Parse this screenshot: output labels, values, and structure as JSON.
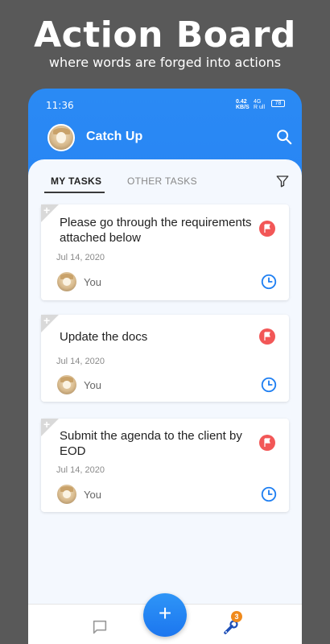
{
  "promo": {
    "title": "Action Board",
    "subtitle": "where words are forged into actions"
  },
  "status_bar": {
    "time": "11:36",
    "network_speed_top": "0.42",
    "network_speed_bottom": "KB/S",
    "signal_top": "4G",
    "signal_bottom": "R ull",
    "battery": "78"
  },
  "app_bar": {
    "title": "Catch Up",
    "avatar_icon": "user-avatar",
    "search_icon": "search-icon"
  },
  "tabs": {
    "active": "MY TASKS",
    "inactive": "OTHER TASKS",
    "filter_icon": "filter-icon"
  },
  "tasks": [
    {
      "title": "Please go through the requirements attached below",
      "date": "Jul 14, 2020",
      "assignee": "You"
    },
    {
      "title": "Update the docs",
      "date": "Jul 14, 2020",
      "assignee": "You"
    },
    {
      "title": "Submit the agenda to the client by EOD",
      "date": "Jul 14, 2020",
      "assignee": "You"
    }
  ],
  "bottom_nav": {
    "fab_label": "+",
    "badge_count": "3"
  },
  "colors": {
    "accent": "#1f7ff2",
    "flag": "#f25757",
    "badge": "#f08a1c"
  }
}
